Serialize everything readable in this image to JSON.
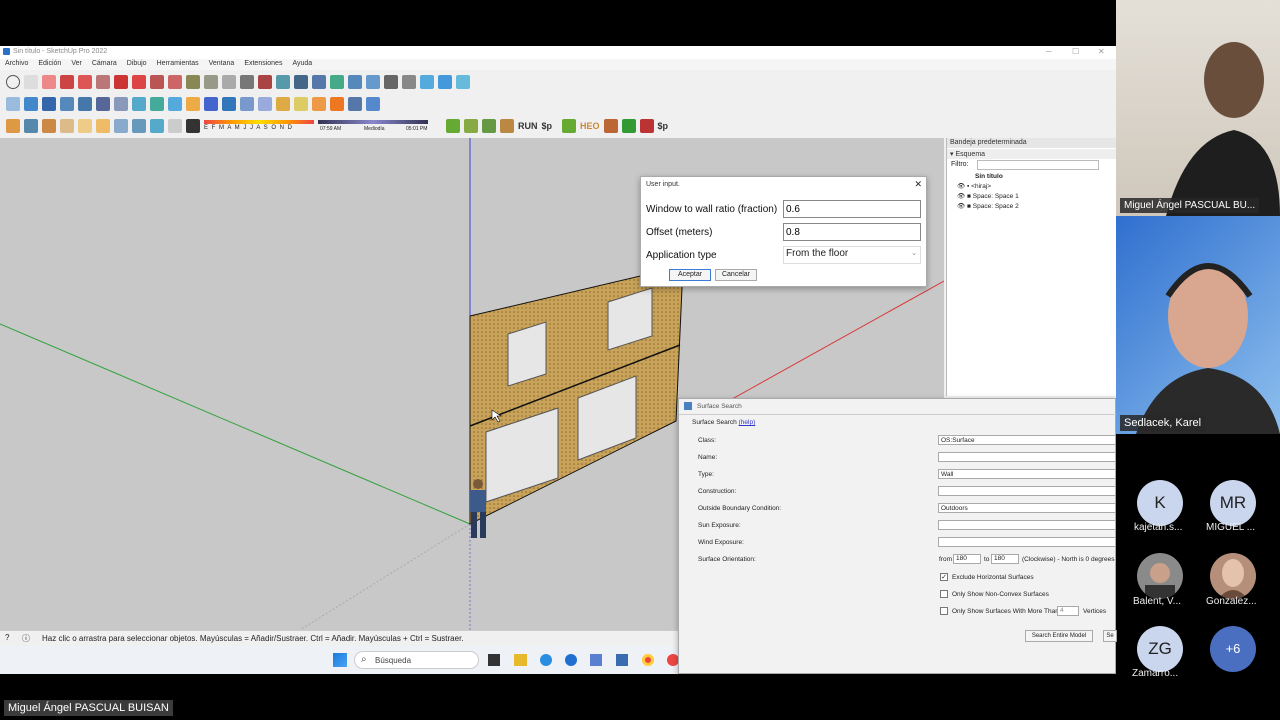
{
  "window": {
    "title": "Sin título - SketchUp Pro 2022"
  },
  "menu": [
    "Archivo",
    "Edición",
    "Ver",
    "Cámara",
    "Dibujo",
    "Herramientas",
    "Ventana",
    "Extensiones",
    "Ayuda"
  ],
  "shadow_bar": {
    "months": "E F M A M J J A S O N D",
    "time_start": "07:59 AM",
    "midday": "Mediodía",
    "time_end": "05:01 PM"
  },
  "toolbar_text": {
    "run": "RUN",
    "sp": "$p",
    "heo": "HEO",
    "sp2": "$p"
  },
  "tray": {
    "title": "Bandeja predeterminada",
    "section": "Esquema",
    "filter_label": "Filtro:",
    "items": [
      "Sin título",
      "<hiraj>",
      "Space: Space 1",
      "Space: Space 2"
    ]
  },
  "user_input": {
    "title": "User input.",
    "wwr_label": "Window to wall ratio (fraction)",
    "wwr_value": "0.6",
    "offset_label": "Offset (meters)",
    "offset_value": "0.8",
    "app_label": "Application type",
    "app_value": "From the floor",
    "ok": "Aceptar",
    "cancel": "Cancelar"
  },
  "surface_search": {
    "title": "Surface Search",
    "subtitle": "Surface Search",
    "help": "(help)",
    "class_label": "Class:",
    "class_value": "OS:Surface",
    "name_label": "Name:",
    "name_value": "",
    "type_label": "Type:",
    "type_value": "Wall",
    "construction_label": "Construction:",
    "obc_label": "Outside Boundary Condition:",
    "obc_value": "Outdoors",
    "sun_label": "Sun Exposure:",
    "wind_label": "Wind Exposure:",
    "orient_label": "Surface Orientation:",
    "orient_from": "from",
    "orient_from_val": "180",
    "orient_to": "to",
    "orient_to_val": "180",
    "orient_note": "(Clockwise) - North is 0 degrees",
    "cb1": "Exclude Horizontal Surfaces",
    "cb1_checked": true,
    "cb2": "Only Show Non-Convex Surfaces",
    "cb3": "Only Show Surfaces With More Than",
    "cb3_val": "4",
    "cb3_suffix": "Vertices",
    "btn_search": "Search Entire Model",
    "btn_sel": "Se"
  },
  "status_text": "Haz clic o arrastra para seleccionar objetos. Mayúsculas = Añadir/Sustraer. Ctrl = Añadir. Mayúsculas + Ctrl = Sustraer.",
  "taskbar": {
    "search_placeholder": "Búsqueda"
  },
  "participants": {
    "tile1_name": "Miguel Ángel PASCUAL BU...",
    "tile2_name": "Sedlacek, Karel",
    "avatars": [
      {
        "initials": "K",
        "name": "kajetan.s...",
        "color": "#c9d6ee"
      },
      {
        "initials": "MR",
        "name": "MIGUEL ...",
        "color": "#c9d6ee"
      },
      {
        "initials": "",
        "name": "Balent, V...",
        "color": "#8a8a8a"
      },
      {
        "initials": "",
        "name": "Gonzalez...",
        "color": "#b58f7a"
      },
      {
        "initials": "ZG",
        "name": "Zamarro...",
        "color": "#c9d6ee"
      },
      {
        "initials": "+6",
        "name": "",
        "color": "#4a6fc0"
      }
    ]
  },
  "presenter_name": "Miguel Ángel PASCUAL BUISAN"
}
